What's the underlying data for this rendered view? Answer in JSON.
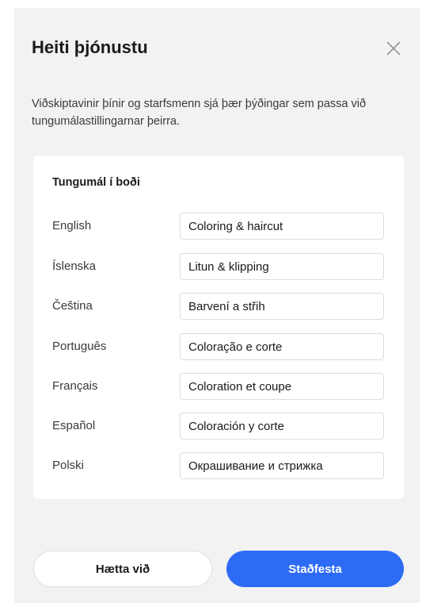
{
  "dialog": {
    "title": "Heiti þjónustu",
    "close_icon": "close-icon",
    "description": "Viðskiptavinir þínir og starfsmenn sjá þær þýðingar sem passa við tungumálastillingarnar þeirra."
  },
  "languages": {
    "heading": "Tungumál í boði",
    "items": [
      {
        "language": "English",
        "value": "Coloring & haircut"
      },
      {
        "language": "Íslenska",
        "value": "Litun & klipping"
      },
      {
        "language": "Čeština",
        "value": "Barvení a střih"
      },
      {
        "language": "Português",
        "value": "Coloração e corte"
      },
      {
        "language": "Français",
        "value": "Coloration et coupe"
      },
      {
        "language": "Español",
        "value": "Coloración y corte"
      },
      {
        "language": "Polski",
        "value": "Окрашивание и стрижка"
      }
    ]
  },
  "actions": {
    "cancel_label": "Hætta við",
    "confirm_label": "Staðfesta",
    "confirm_color": "#2d6bf5"
  }
}
